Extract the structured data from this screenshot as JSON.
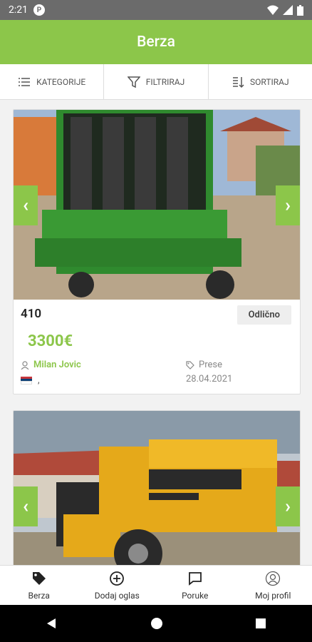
{
  "status": {
    "time": "2:21"
  },
  "appbar": {
    "title": "Berza"
  },
  "toolbar": {
    "categories": "KATEGORIJE",
    "filter": "FILTRIRAJ",
    "sort": "SORTIRAJ"
  },
  "listings": [
    {
      "title": "410",
      "condition": "Odlično",
      "price": "3300€",
      "seller": "Milan Jovic",
      "location": ",",
      "category": "Prese",
      "date": "28.04.2021"
    },
    {
      "title": "",
      "condition": "",
      "price": "",
      "seller": "",
      "location": "",
      "category": "",
      "date": ""
    }
  ],
  "bottomnav": {
    "berza": "Berza",
    "add": "Dodaj oglas",
    "messages": "Poruke",
    "profile": "Moj profil"
  },
  "colors": {
    "accent": "#8cc64a"
  }
}
